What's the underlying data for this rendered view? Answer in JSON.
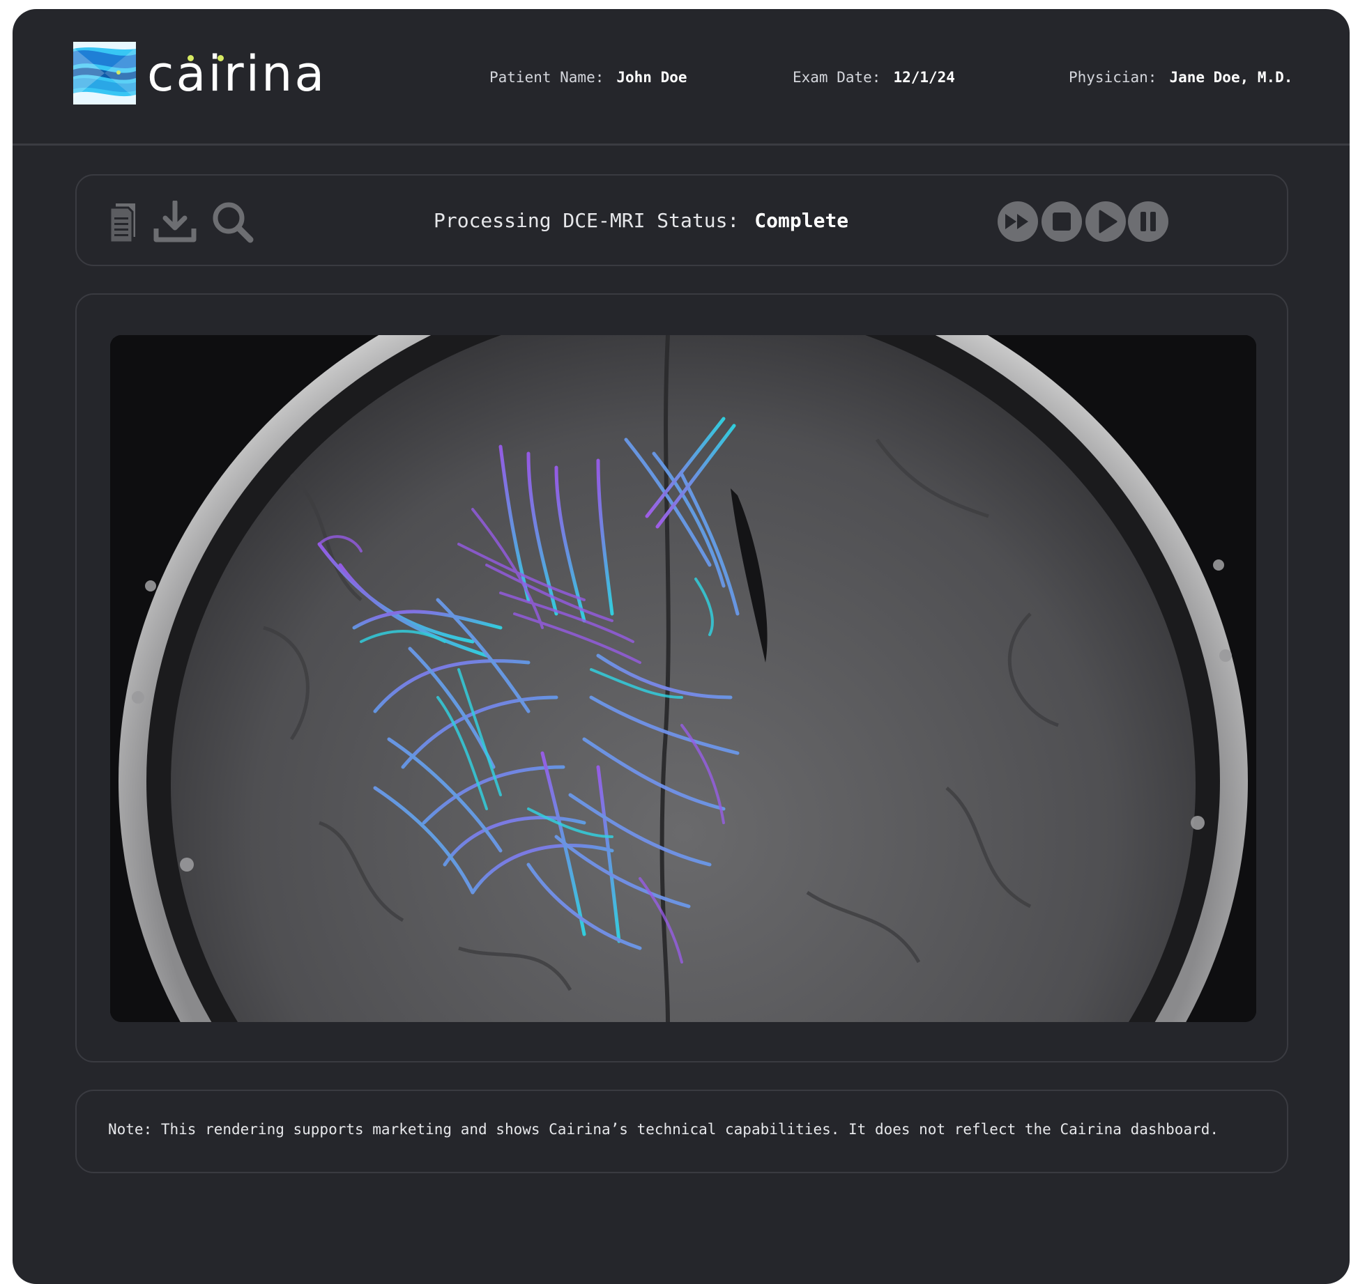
{
  "brand": {
    "name": "cairina"
  },
  "header": {
    "patient_label": "Patient Name:",
    "patient_value": "John Doe",
    "exam_label": "Exam Date:",
    "exam_value": "12/1/24",
    "physician_label": "Physician:",
    "physician_value": "Jane Doe, M.D."
  },
  "toolbar": {
    "icons": [
      "document-icon",
      "download-icon",
      "search-icon"
    ],
    "status_label": "Processing DCE-MRI Status:",
    "status_value": "Complete",
    "controls": [
      "fast-forward-icon",
      "stop-icon",
      "play-icon",
      "pause-icon"
    ]
  },
  "viewer": {
    "image": "Axial brain MRI slice with purple and cyan tractography fibers overlay"
  },
  "note": {
    "text": "Note: This rendering supports marketing and shows Cairina’s technical capabilities. It does not reflect the Cairina dashboard."
  },
  "colors": {
    "background": "#25262b",
    "panel_border": "#3a3b41",
    "icon_gray": "#6d6e72",
    "fiber_purple": "#9b5cf0",
    "fiber_cyan": "#2fd8e8",
    "logo_blue": "#1f7fd6",
    "logo_cyan": "#38c6f4",
    "logo_dot": "#d7ea63"
  }
}
